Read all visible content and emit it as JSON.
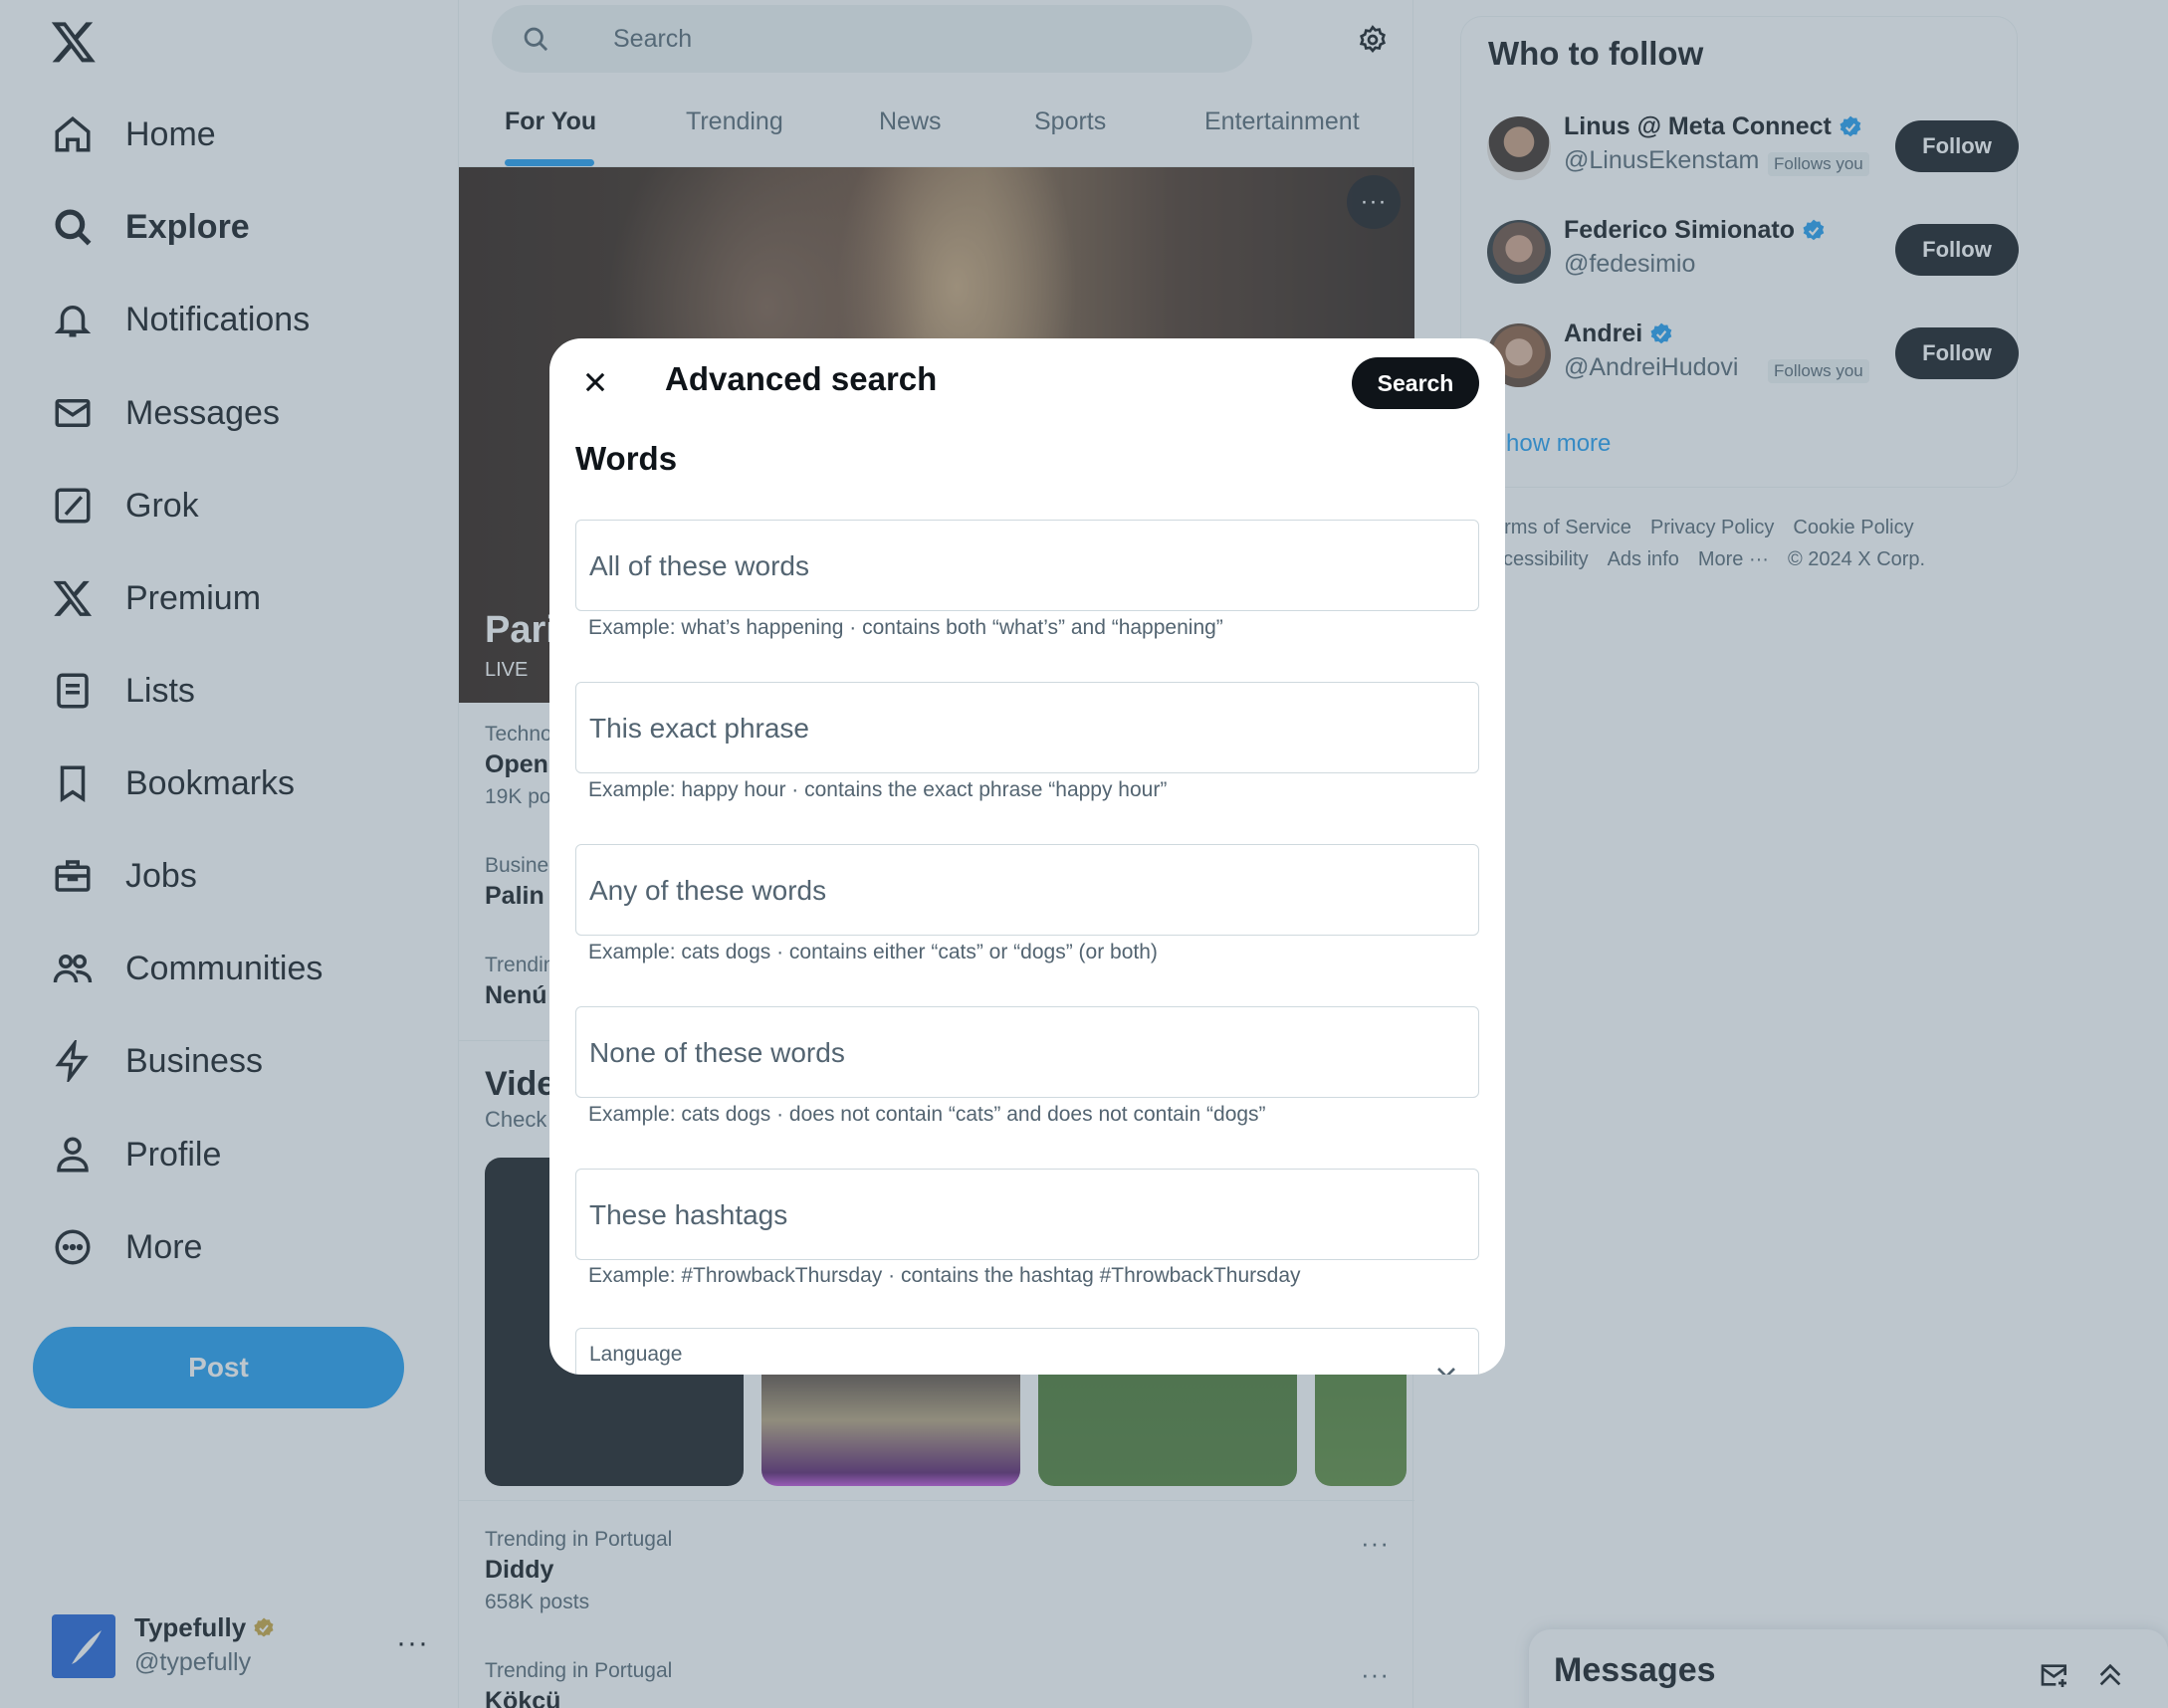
{
  "sidebar": {
    "logo_icon": "x-logo-icon",
    "items": [
      {
        "label": "Home",
        "icon": "home-icon"
      },
      {
        "label": "Explore",
        "icon": "search-icon"
      },
      {
        "label": "Notifications",
        "icon": "bell-icon"
      },
      {
        "label": "Messages",
        "icon": "envelope-icon"
      },
      {
        "label": "Grok",
        "icon": "grok-icon"
      },
      {
        "label": "Premium",
        "icon": "x-logo-icon"
      },
      {
        "label": "Lists",
        "icon": "list-icon"
      },
      {
        "label": "Bookmarks",
        "icon": "bookmark-icon"
      },
      {
        "label": "Jobs",
        "icon": "briefcase-icon"
      },
      {
        "label": "Communities",
        "icon": "people-icon"
      },
      {
        "label": "Business",
        "icon": "lightning-icon"
      },
      {
        "label": "Profile",
        "icon": "person-icon"
      },
      {
        "label": "More",
        "icon": "more-circle-icon"
      }
    ],
    "active_item": "Explore",
    "post_label": "Post",
    "account": {
      "name": "Typefully",
      "handle": "@typefully",
      "more": "···"
    }
  },
  "search": {
    "placeholder": "Search"
  },
  "tabs": [
    {
      "label": "For You",
      "active": true
    },
    {
      "label": "Trending",
      "active": false
    },
    {
      "label": "News",
      "active": false
    },
    {
      "label": "Sports",
      "active": false
    },
    {
      "label": "Entertainment",
      "active": false
    }
  ],
  "hero": {
    "title": "Pari",
    "badge": "LIVE",
    "more": "···"
  },
  "partial_trends": [
    {
      "context": "Techno",
      "name": "Open",
      "count": "19K po"
    },
    {
      "context": "Busine",
      "name": "Palin",
      "count": ""
    },
    {
      "context": "Trendin",
      "name": "Nenú",
      "count": ""
    }
  ],
  "videos": {
    "title": "Vide",
    "subtitle": "Check"
  },
  "trends": [
    {
      "context": "Trending in Portugal",
      "name": "Diddy",
      "count": "658K posts",
      "more": "···"
    },
    {
      "context": "Trending in Portugal",
      "name": "Kökçü",
      "count": "",
      "more": "···"
    }
  ],
  "who_to_follow": {
    "title": "Who to follow",
    "follow_label": "Follow",
    "accounts": [
      {
        "name": "Linus @ Meta Connect",
        "handle": "@LinusEkenstam",
        "follows_you": "Follows you",
        "verified": true
      },
      {
        "name": "Federico Simionato",
        "handle": "@fedesimio",
        "follows_you": "",
        "verified": true
      },
      {
        "name": "Andrei",
        "handle": "@AndreiHudovi",
        "follows_you": "Follows you",
        "verified": true
      }
    ],
    "show_more": "how more"
  },
  "footer": {
    "row1": [
      "erms of Service",
      "Privacy Policy",
      "Cookie Policy"
    ],
    "row2": [
      "ccessibility",
      "Ads info",
      "More ···",
      "© 2024 X Corp."
    ]
  },
  "messages_drawer": {
    "title": "Messages"
  },
  "modal": {
    "title": "Advanced search",
    "search_button": "Search",
    "section": "Words",
    "fields": [
      {
        "placeholder": "All of these words",
        "hint": "Example: what’s happening · contains both “what’s” and “happening”"
      },
      {
        "placeholder": "This exact phrase",
        "hint": "Example: happy hour · contains the exact phrase “happy hour”"
      },
      {
        "placeholder": "Any of these words",
        "hint": "Example: cats dogs · contains either “cats” or “dogs” (or both)"
      },
      {
        "placeholder": "None of these words",
        "hint": "Example: cats dogs · does not contain “cats” and does not contain “dogs”"
      },
      {
        "placeholder": "These hashtags",
        "hint": "Example: #ThrowbackThursday · contains the hashtag #ThrowbackThursday"
      }
    ],
    "language_label": "Language"
  },
  "colors": {
    "accent": "#1d9bf0",
    "text": "#0f1419",
    "muted": "#536471",
    "verified": "#1d9bf0",
    "gold_badge": "#c9a43b"
  }
}
